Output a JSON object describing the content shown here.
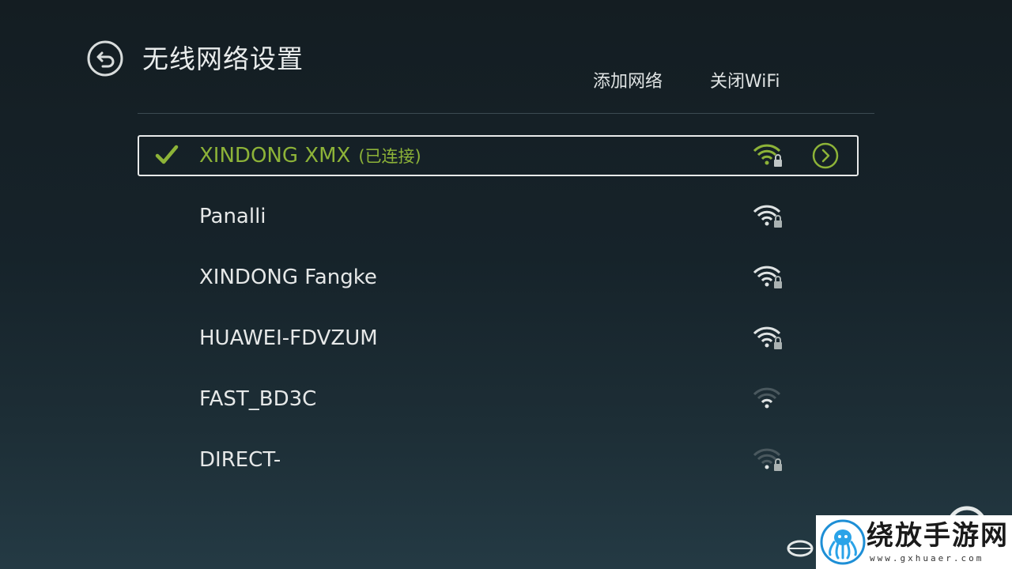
{
  "header": {
    "title": "无线网络设置",
    "back_icon": "back-arrow-icon",
    "actions": {
      "add_network": "添加网络",
      "close_wifi": "关闭WiFi"
    }
  },
  "networks": [
    {
      "ssid": "XINDONG XMX",
      "status": "(已连接)",
      "connected": true,
      "signal_bars": 4,
      "secured": true
    },
    {
      "ssid": "Panalli",
      "status": "",
      "connected": false,
      "signal_bars": 4,
      "secured": true
    },
    {
      "ssid": "XINDONG Fangke",
      "status": "",
      "connected": false,
      "signal_bars": 4,
      "secured": true
    },
    {
      "ssid": "HUAWEI-FDVZUM",
      "status": "",
      "connected": false,
      "signal_bars": 4,
      "secured": true
    },
    {
      "ssid": "FAST_BD3C",
      "status": "",
      "connected": false,
      "signal_bars": 2,
      "secured": false
    },
    {
      "ssid": "DIRECT-",
      "status": "",
      "connected": false,
      "signal_bars": 1,
      "secured": true
    }
  ],
  "watermark": {
    "brand": "绕放手游网",
    "url": "www.gxhuaer.com"
  },
  "colors": {
    "accent": "#8db338",
    "text": "#e6e8e8",
    "divider": "#3b4a52"
  }
}
